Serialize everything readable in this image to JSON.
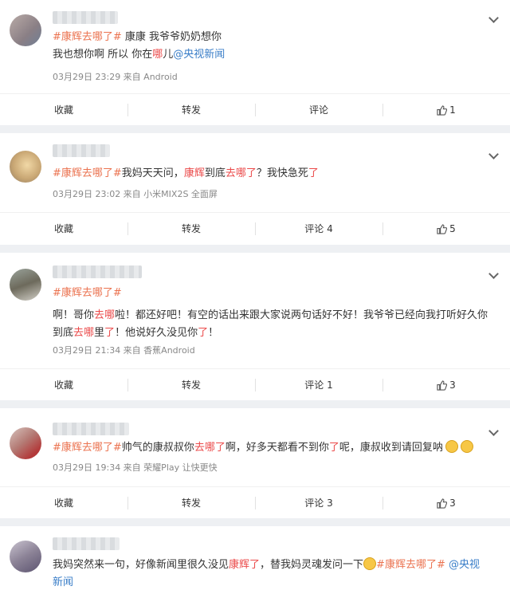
{
  "posts": [
    {
      "line1": [
        {
          "t": "#康辉去哪了#",
          "c": "t"
        },
        {
          "t": " 康康 我爷爷奶奶想你",
          "c": ""
        }
      ],
      "line2": [
        {
          "t": "我也想你啊 所以 你在",
          "c": ""
        },
        {
          "t": "哪",
          "c": "r"
        },
        {
          "t": "儿",
          "c": ""
        },
        {
          "t": "@央视新闻",
          "c": "at"
        }
      ],
      "meta": "03月29日 23:29  来自 Android",
      "actions": {
        "fav": "收藏",
        "repost": "转发",
        "comment": "评论",
        "like": "1"
      }
    },
    {
      "line1": [
        {
          "t": "#康辉去哪了#",
          "c": "t"
        },
        {
          "t": "我妈天天问，",
          "c": ""
        },
        {
          "t": "康辉",
          "c": "r"
        },
        {
          "t": "到底",
          "c": ""
        },
        {
          "t": "去哪了",
          "c": "r"
        },
        {
          "t": "？我快急死",
          "c": ""
        },
        {
          "t": "了",
          "c": "r"
        }
      ],
      "meta": "03月29日 23:02  来自 小米MIX2S 全面屏",
      "actions": {
        "fav": "收藏",
        "repost": "转发",
        "comment": "评论 4",
        "like": "5"
      }
    },
    {
      "line1": [
        {
          "t": "#康辉去哪了#",
          "c": "t"
        }
      ],
      "line2": [
        {
          "t": "啊！哥你",
          "c": ""
        },
        {
          "t": "去哪",
          "c": "r"
        },
        {
          "t": "啦！都还好吧！有空的话出来跟大家说两句话好不好！我爷爷已经向我打听好久你",
          "c": ""
        }
      ],
      "line3": [
        {
          "t": "到底",
          "c": ""
        },
        {
          "t": "去哪",
          "c": "r"
        },
        {
          "t": "里",
          "c": ""
        },
        {
          "t": "了",
          "c": "r"
        },
        {
          "t": "！他说好久没见你",
          "c": ""
        },
        {
          "t": "了",
          "c": "r"
        },
        {
          "t": "！",
          "c": ""
        }
      ],
      "meta": "03月29日 21:34  来自 香蕉Android",
      "actions": {
        "fav": "收藏",
        "repost": "转发",
        "comment": "评论 1",
        "like": "3"
      }
    },
    {
      "line1": [
        {
          "t": "#康辉去哪了#",
          "c": "t"
        },
        {
          "t": "帅气的康叔叔你",
          "c": ""
        },
        {
          "t": "去哪了",
          "c": "r"
        },
        {
          "t": "啊，好多天都看不到你",
          "c": ""
        },
        {
          "t": "了",
          "c": "r"
        },
        {
          "t": "呢，康叔收到请回复呐",
          "c": ""
        }
      ],
      "meta": "03月29日 19:34  来自 荣耀Play 让快更快",
      "actions": {
        "fav": "收藏",
        "repost": "转发",
        "comment": "评论 3",
        "like": "3"
      }
    },
    {
      "line1": [
        {
          "t": "我妈突然来一句，好像新闻里很久没见",
          "c": ""
        },
        {
          "t": "康辉了",
          "c": "r"
        },
        {
          "t": "，替我妈灵魂发问一下",
          "c": ""
        },
        {
          "t": "#康辉去哪了#",
          "c": "t"
        },
        {
          "t": " @央视",
          "c": "at"
        }
      ],
      "line2": [
        {
          "t": "新闻",
          "c": "at"
        }
      ]
    }
  ],
  "colors": {
    "topic": "#eb7350",
    "highlight": "#eb4a4a",
    "mention": "#3a7ec8",
    "meta": "#888888"
  }
}
